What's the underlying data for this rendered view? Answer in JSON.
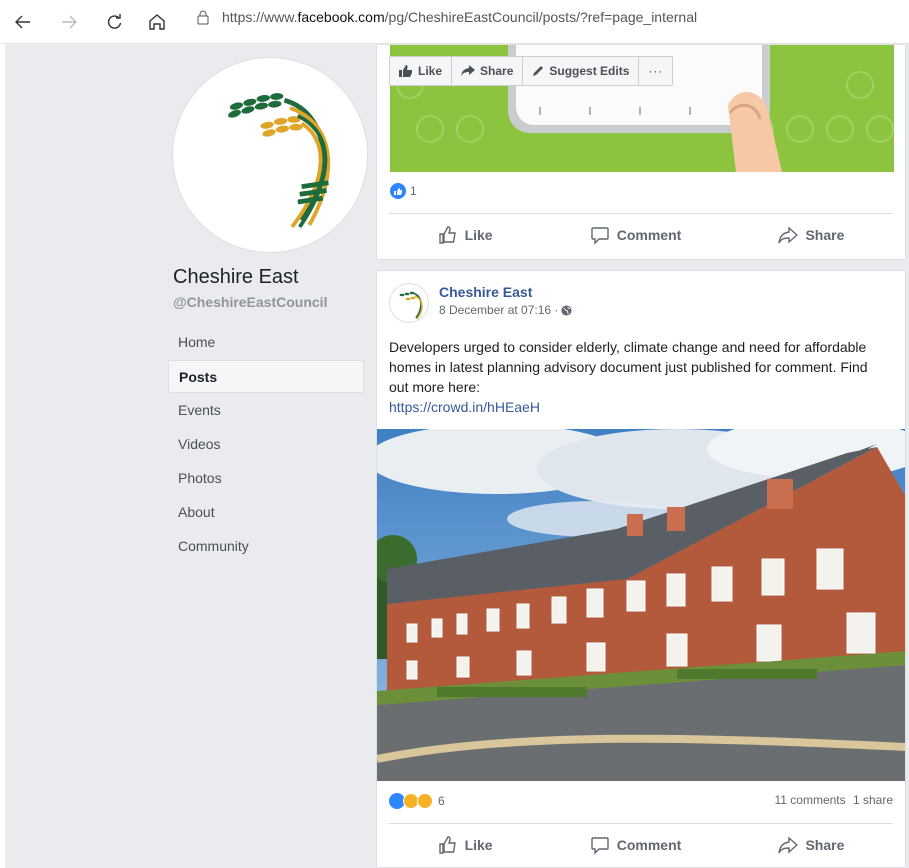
{
  "browser": {
    "url_prefix": "https://www.",
    "url_domain": "facebook.com",
    "url_path": "/pg/CheshireEastCouncil/posts/?ref=page_internal"
  },
  "sidebar": {
    "page_name": "Cheshire East",
    "handle": "@CheshireEastCouncil",
    "items": [
      {
        "label": "Home"
      },
      {
        "label": "Posts"
      },
      {
        "label": "Events"
      },
      {
        "label": "Videos"
      },
      {
        "label": "Photos"
      },
      {
        "label": "About"
      },
      {
        "label": "Community"
      }
    ]
  },
  "toolbar": {
    "like": "Like",
    "share": "Share",
    "suggest": "Suggest Edits",
    "more": "···"
  },
  "post1": {
    "reaction_count": "1",
    "actions": {
      "like": "Like",
      "comment": "Comment",
      "share": "Share"
    }
  },
  "post2": {
    "author": "Cheshire East",
    "time": "8 December at 07:16 ·",
    "text": "Developers urged to consider elderly, climate change and need for affordable homes in latest planning advisory document just published for comment. Find out more here:",
    "link": "https://crowd.in/hHEaeH",
    "reaction_count": "6",
    "comments": "11 comments",
    "shares": "1 share",
    "actions": {
      "like": "Like",
      "comment": "Comment",
      "share": "Share"
    }
  },
  "colors": {
    "fb_blue": "#385898",
    "page_bg": "#e9ebee",
    "logo_green": "#1e6b3c",
    "logo_gold": "#e0a526",
    "post_green": "#8cc43f"
  }
}
